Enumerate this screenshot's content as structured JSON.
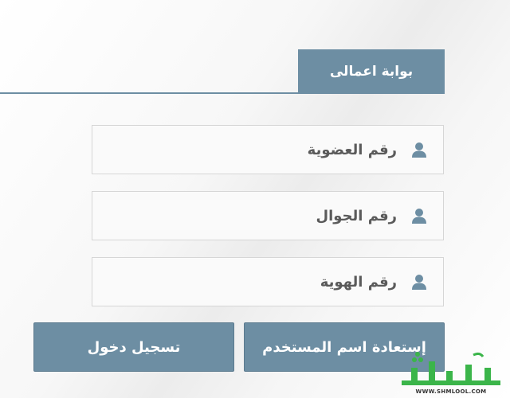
{
  "portal": {
    "title": "بوابة اعمالى"
  },
  "form": {
    "membership_placeholder": "رقم العضوية",
    "mobile_placeholder": "رقم الجوال",
    "id_placeholder": "رقم الهوية"
  },
  "buttons": {
    "recover_label": "إستعادة اسم المستخدم",
    "login_label": "تسجيل دخول"
  },
  "watermark": {
    "logo_text": "شملول",
    "url": "WWW.SHMLOOL.COM"
  },
  "icons": {
    "field_icon": "user-icon"
  },
  "colors": {
    "accent": "#6d8ea3",
    "field_text": "#5a5a5a",
    "watermark_green": "#3bb54a"
  }
}
